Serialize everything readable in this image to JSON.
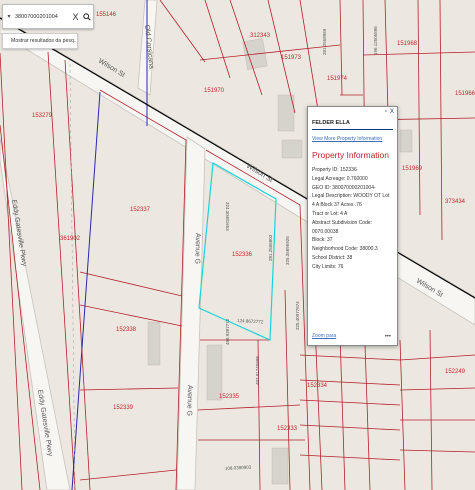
{
  "search": {
    "value": "38007000201004",
    "clear_glyph": "X",
    "search_icon": "search-icon",
    "suggestion": "Mostrar resultados da pesq..."
  },
  "popup": {
    "owner": "FELDER ELLA",
    "link": "View More Property Information",
    "heading": "Property Information",
    "fields": [
      "Property ID: 152336",
      "Legal Acreage: 0.760000",
      "GEO ID: 380070000201004-",
      "Legal Description: WOODY OT Lot 4 A Block 37 Acres .76",
      "Tract or Lot: 4 A",
      "Abstract Subdivision Code: 0070.00038",
      "Block: 37",
      "Neighborhood Code: 38000.3",
      "School District: 38",
      "City Limits: 76"
    ],
    "zoom": "Zoom para",
    "more": "•••",
    "restore_glyph": "▫",
    "close_glyph": "X"
  },
  "streets": {
    "wilson_1": "Wilson St",
    "wilson_2": "Wilson St",
    "wilson_3": "Wilson St",
    "old_corsicana": "Old Corsicana",
    "avenue_g_1": "Avenue G",
    "avenue_g_2": "Avenue G",
    "eddy_gatesville_1": "Eddy Gatesville Pkwy",
    "eddy_gatesville_2": "Eddy Gatesville Pkwy"
  },
  "parcels": {
    "p152336": "152336",
    "p152337": "152337",
    "p152338": "152338",
    "p152339": "152339",
    "p152335": "152335",
    "p152333": "152333",
    "p152334": "152334",
    "p152249": "152249",
    "p153279": "153279",
    "p151970": "151970",
    "p151974": "151974",
    "p151973": "151973",
    "p151968": "151968",
    "p151966": "151966",
    "p151969": "151969",
    "p373434": "373434",
    "p361902": "361902",
    "p312343": "312343",
    "p155146": "155146"
  },
  "dimensions": {
    "d1": "324.30481653",
    "d2": "124.8672772",
    "d3": "281.2506803",
    "d4": "325.35895926",
    "d5": "325.40977674",
    "d6": "458.9387772",
    "d7": "487.91745998",
    "d8": "281.2558969",
    "d9": "196.12505896",
    "d10": "108.0390903"
  },
  "colors": {
    "background": "#ece8e1",
    "parcel_line": "#b5202a",
    "selected_parcel": "#19d3d8",
    "boundary": "#2a2aa8",
    "road_border": "#c7c2bc",
    "rail": "#000000"
  }
}
